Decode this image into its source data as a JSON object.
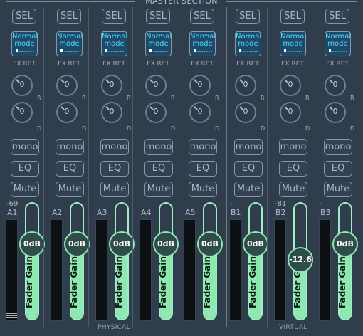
{
  "header": {
    "title": "MASTER SECTION"
  },
  "groups": [
    {
      "label": "PHYSICAL"
    },
    {
      "label": "VIRTUAL"
    }
  ],
  "colors": {
    "background": "#2f3d4d",
    "fader": "#8fe8b2",
    "mode_text": "#4fd9ff",
    "button_border": "#8898a8"
  },
  "strips": [
    {
      "name": "A1",
      "level": "-69",
      "meter_level": 0.08,
      "fader_fill": 0.65,
      "fader_value": "0dB",
      "fader_label": "Fader Gain"
    },
    {
      "name": "A2",
      "level": "",
      "meter_level": 0,
      "fader_fill": 0.65,
      "fader_value": "0dB",
      "fader_label": "Fader Gain"
    },
    {
      "name": "A3",
      "level": "",
      "meter_level": 0,
      "fader_fill": 0.65,
      "fader_value": "0dB",
      "fader_label": "Fader Gain"
    },
    {
      "name": "A4",
      "level": "",
      "meter_level": 0,
      "fader_fill": 0.65,
      "fader_value": "0dB",
      "fader_label": "Fader Gain"
    },
    {
      "name": "A5",
      "level": "",
      "meter_level": 0,
      "fader_fill": 0.65,
      "fader_value": "0dB",
      "fader_label": "Fader Gain"
    },
    {
      "name": "B1",
      "level": "-",
      "meter_level": 0,
      "fader_fill": 0.65,
      "fader_value": "0dB",
      "fader_label": "Fader Gain"
    },
    {
      "name": "B2",
      "level": "-81",
      "meter_level": 0,
      "fader_fill": 0.51,
      "fader_value": "-12.6",
      "fader_label": "Fader Gain"
    },
    {
      "name": "B3",
      "level": "-",
      "meter_level": 0,
      "fader_fill": 0.65,
      "fader_value": "0dB",
      "fader_label": "Fader Gain"
    }
  ],
  "labels": {
    "sel": "SEL",
    "mode": [
      "Normal",
      "mode"
    ],
    "fx": "FX RET.",
    "knob_value": "0",
    "r": "R",
    "d": "D",
    "mono": "mono",
    "eq": "EQ",
    "mute": "Mute"
  },
  "icons": {
    "knob": "rotary-knob-icon",
    "mode_dots": "dot-grid-icon"
  }
}
